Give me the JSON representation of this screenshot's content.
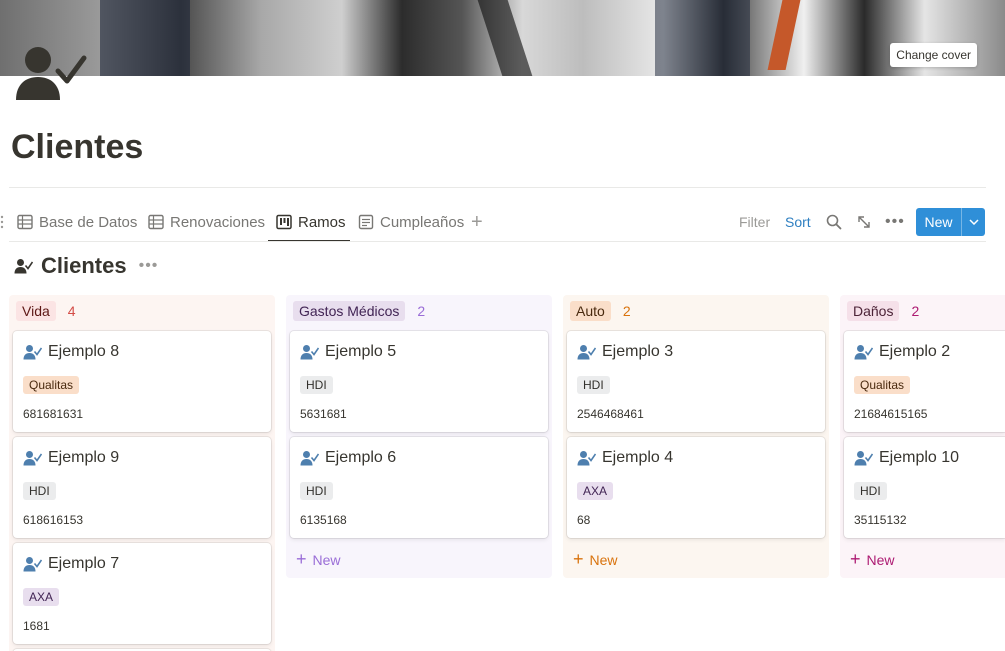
{
  "cover": {
    "change_cover_label": "Change cover"
  },
  "page": {
    "title": "Clientes"
  },
  "tabs": [
    {
      "label": "Base de Datos",
      "icon": "table-icon"
    },
    {
      "label": "Renovaciones",
      "icon": "table-icon"
    },
    {
      "label": "Ramos",
      "icon": "board-icon"
    },
    {
      "label": "Cumpleaños",
      "icon": "list-icon"
    }
  ],
  "toolbar": {
    "filter": "Filter",
    "sort": "Sort",
    "new": "New"
  },
  "collection": {
    "title": "Clientes"
  },
  "colors": {
    "accent": "#2f8fd8",
    "sort_link": "#2e7fc1"
  },
  "board": {
    "new_label": "New",
    "columns": [
      {
        "name": "Vida",
        "count": "4",
        "tag_bg": "#fbe4e4",
        "tag_color": "#5d1715",
        "count_color": "#d44c47",
        "col_bg": "#fdf5f2",
        "cards": [
          {
            "title": "Ejemplo 8",
            "badge": "Qualitas",
            "number": "681681631"
          },
          {
            "title": "Ejemplo 9",
            "badge": "HDI",
            "number": "618616153"
          },
          {
            "title": "Ejemplo 7",
            "badge": "AXA",
            "number": "1681"
          }
        ]
      },
      {
        "name": "Gastos Médicos",
        "count": "2",
        "tag_bg": "#e8deee",
        "tag_color": "#412454",
        "count_color": "#9a6dd7",
        "col_bg": "#f8f5fc",
        "cards": [
          {
            "title": "Ejemplo 5",
            "badge": "HDI",
            "number": "5631681"
          },
          {
            "title": "Ejemplo 6",
            "badge": "HDI",
            "number": "6135168"
          }
        ]
      },
      {
        "name": "Auto",
        "count": "2",
        "tag_bg": "#fadec9",
        "tag_color": "#49290e",
        "count_color": "#d9730d",
        "col_bg": "#fcf6f0",
        "cards": [
          {
            "title": "Ejemplo 3",
            "badge": "HDI",
            "number": "2546468461"
          },
          {
            "title": "Ejemplo 4",
            "badge": "AXA",
            "number": "68"
          }
        ]
      },
      {
        "name": "Daños",
        "count": "2",
        "tag_bg": "#f5e0e9",
        "tag_color": "#4c2337",
        "count_color": "#ad1a72",
        "col_bg": "#fcf4f8",
        "cards": [
          {
            "title": "Ejemplo 2",
            "badge": "Qualitas",
            "number": "21684615165"
          },
          {
            "title": "Ejemplo 10",
            "badge": "HDI",
            "number": "35115132"
          }
        ]
      }
    ]
  }
}
